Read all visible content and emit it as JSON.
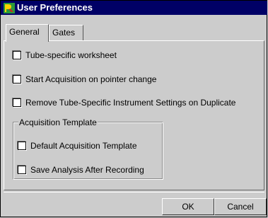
{
  "window": {
    "title": "User Preferences",
    "icon": "app-icon"
  },
  "tabs": [
    {
      "label": "General",
      "active": true
    },
    {
      "label": "Gates",
      "active": false
    }
  ],
  "general": {
    "options": [
      {
        "label": "Tube-specific worksheet",
        "checked": false
      },
      {
        "label": "Start Acquisition on pointer change",
        "checked": false
      },
      {
        "label": "Remove Tube-Specific Instrument Settings on Duplicate",
        "checked": false
      }
    ],
    "acquisition_template": {
      "legend": "Acquisition Template",
      "options": [
        {
          "label": "Default Acquisition Template",
          "checked": false
        },
        {
          "label": "Save Analysis After Recording",
          "checked": false
        }
      ]
    }
  },
  "buttons": {
    "ok": "OK",
    "cancel": "Cancel"
  },
  "colors": {
    "titlebar": "#000066",
    "background": "#cccccc"
  }
}
